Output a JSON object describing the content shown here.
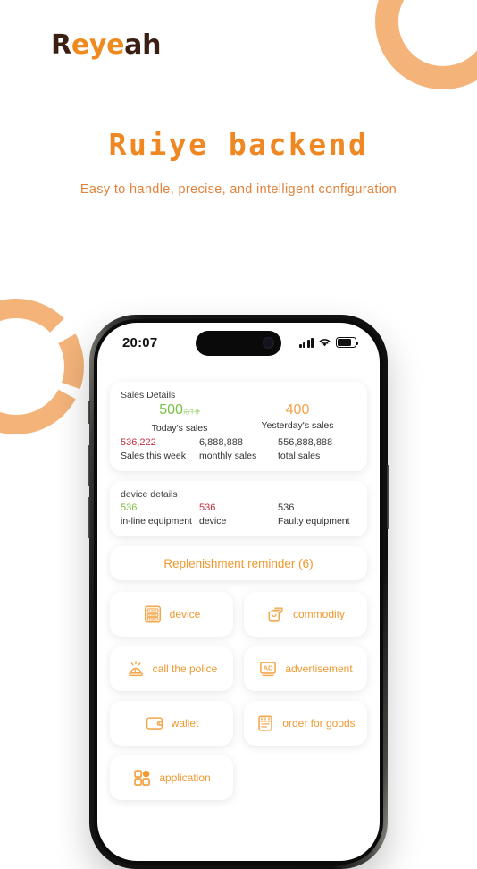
{
  "brand": {
    "part1": "R",
    "part2": "eye",
    "part3": "ah"
  },
  "headline": "Ruiye backend",
  "subhead": "Easy to handle, precise, and intelligent configuration",
  "colors": {
    "accent": "#ef8722",
    "accent_light": "#f3b379",
    "brand_dark": "#3b1f12",
    "green": "#7ac143",
    "red": "#c0303d"
  },
  "phone": {
    "statusbar": {
      "time": "20:07",
      "signal_icon": "signal-bars-icon",
      "wifi_icon": "wifi-icon",
      "battery_icon": "battery-icon"
    },
    "sales_card": {
      "title": "Sales Details",
      "top_stats": [
        {
          "value": "500",
          "unit": "元/千件",
          "label": "Today's sales",
          "color": "green"
        },
        {
          "value": "400",
          "unit": "",
          "label": "Yesterday's sales",
          "color": "orange"
        }
      ],
      "bottom_stats": [
        {
          "value": "536,222",
          "label": "Sales this week",
          "color": "red"
        },
        {
          "value": "6,888,888",
          "label": "monthly sales",
          "color": "dark"
        },
        {
          "value": "556,888,888",
          "label": "total sales",
          "color": "dark"
        }
      ]
    },
    "device_card": {
      "title": "device details",
      "stats": [
        {
          "value": "536",
          "label": "in-line equipment",
          "color": "green"
        },
        {
          "value": "536",
          "label": "device",
          "color": "red"
        },
        {
          "value": "536",
          "label": "Faulty equipment",
          "color": "dark"
        }
      ]
    },
    "notice": "Replenishment reminder (6)",
    "tiles": [
      {
        "label": "device",
        "icon": "server-list-icon"
      },
      {
        "label": "commodity",
        "icon": "shopping-bag-icon"
      },
      {
        "label": "call the police",
        "icon": "alarm-siren-icon"
      },
      {
        "label": "advertisement",
        "icon": "ad-banner-icon"
      },
      {
        "label": "wallet",
        "icon": "wallet-icon"
      },
      {
        "label": "order for goods",
        "icon": "order-receipt-icon"
      },
      {
        "label": "application",
        "icon": "apps-grid-icon"
      }
    ]
  }
}
